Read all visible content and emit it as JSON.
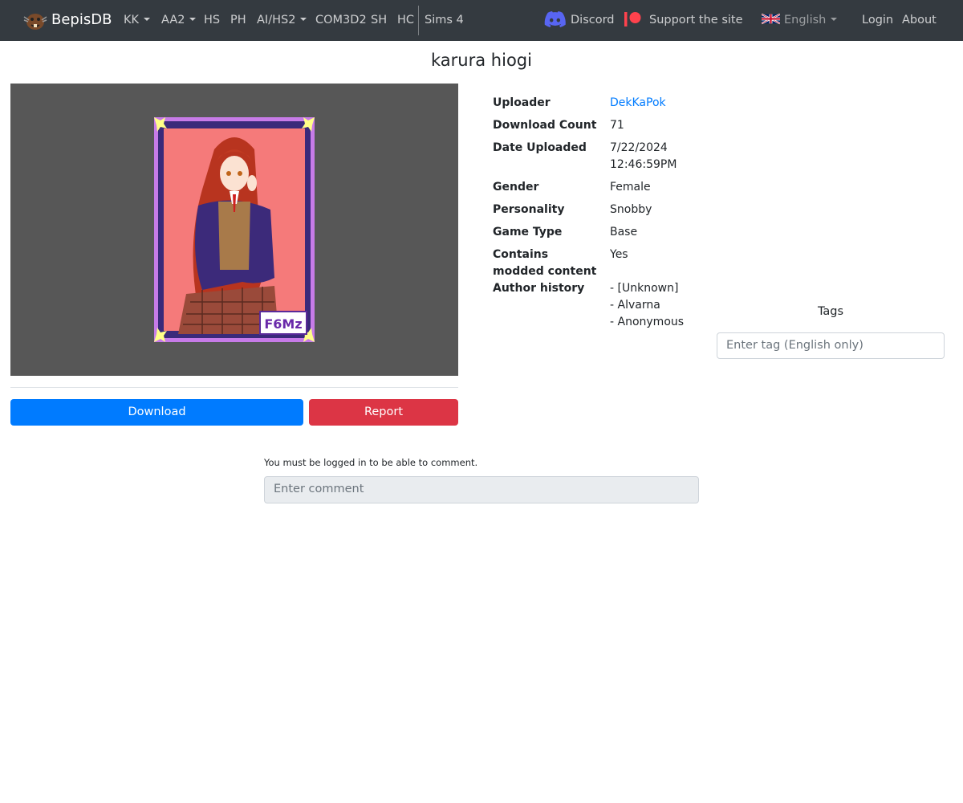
{
  "nav": {
    "brand": "BepisDB",
    "items": [
      {
        "label": "KK",
        "dropdown": true
      },
      {
        "label": "AA2",
        "dropdown": true
      },
      {
        "label": "HS",
        "dropdown": false
      },
      {
        "label": "PH",
        "dropdown": false
      },
      {
        "label": "AI/HS2",
        "dropdown": true
      },
      {
        "label": "COM3D2",
        "dropdown": false
      },
      {
        "label": "SH",
        "dropdown": false
      },
      {
        "label": "HC",
        "dropdown": false
      },
      {
        "label": "Sims 4",
        "dropdown": false
      }
    ],
    "discord": "Discord",
    "support": "Support the site",
    "language": "English",
    "login": "Login",
    "about": "About"
  },
  "card": {
    "title": "karura hiogi",
    "watermark": "F6Mz"
  },
  "details": [
    {
      "label": "Uploader",
      "value": "DekKaPok",
      "link": true
    },
    {
      "label": "Download Count",
      "value": "71"
    },
    {
      "label": "Date Uploaded",
      "value": "7/22/2024",
      "value2": "12:46:59PM"
    },
    {
      "label": "Gender",
      "value": "Female"
    },
    {
      "label": "Personality",
      "value": "Snobby"
    },
    {
      "label": "Game Type",
      "value": "Base"
    },
    {
      "label": "Contains",
      "label2": "modded content",
      "value": "Yes"
    },
    {
      "label": "Author history",
      "history": [
        "- [Unknown]",
        "- Alvarna",
        "- Anonymous"
      ]
    }
  ],
  "actions": {
    "download": "Download",
    "report": "Report"
  },
  "tags": {
    "heading": "Tags",
    "placeholder": "Enter tag (English only)"
  },
  "comments": {
    "note": "You must be logged in to be able to comment.",
    "placeholder": "Enter comment"
  },
  "colors": {
    "navbar": "#343a40",
    "primary": "#007bff",
    "danger": "#dc3545",
    "discord": "#5865f2",
    "patreon": "#ff424d"
  }
}
